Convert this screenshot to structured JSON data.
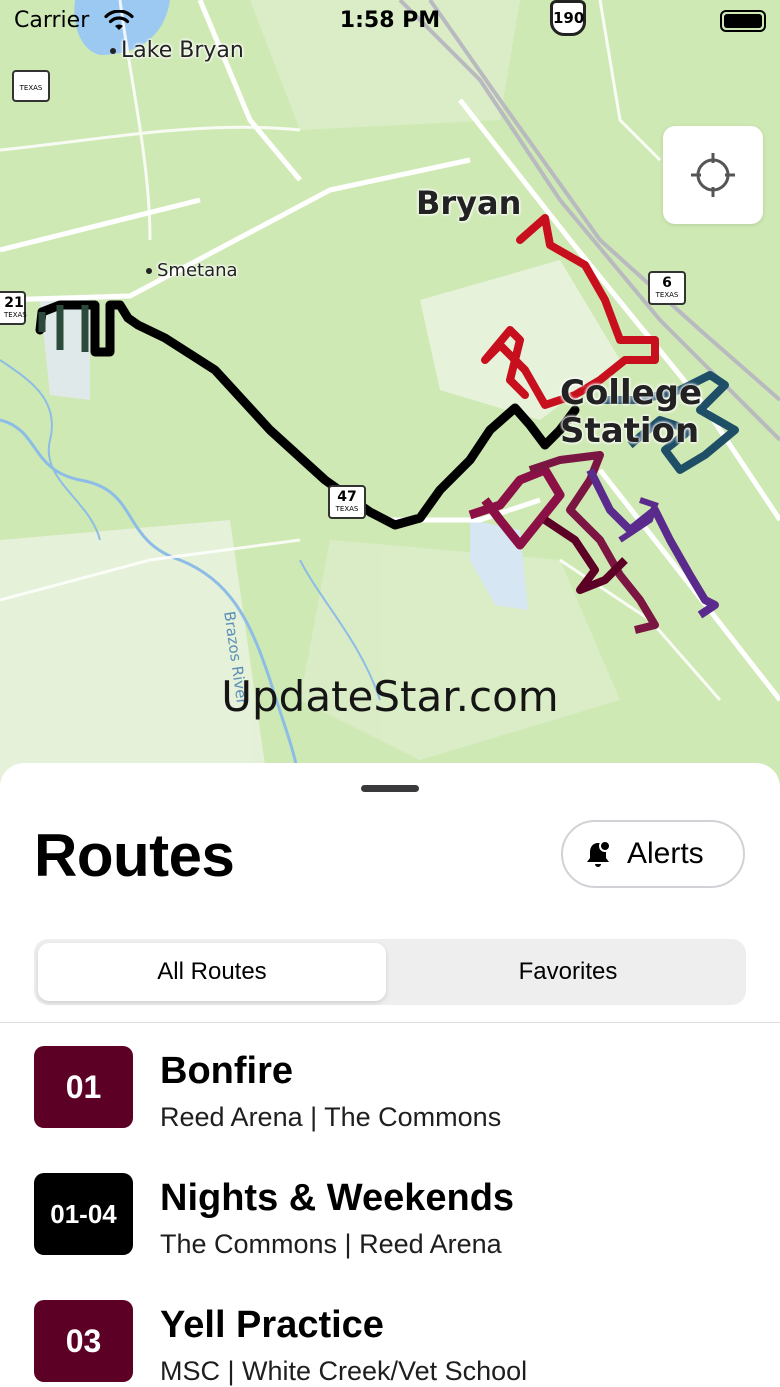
{
  "status_bar": {
    "carrier": "Carrier",
    "time": "1:58 PM"
  },
  "map": {
    "labels": {
      "lake_bryan": "Lake Bryan",
      "bryan": "Bryan",
      "smetana": "Smetana",
      "college_station_line1": "College",
      "college_station_line2": "Station",
      "river": "Brazos River"
    },
    "shields": {
      "texas_top_left": "TEXAS",
      "hwy_21": "21",
      "hwy_21_state": "TEXAS",
      "hwy_6": "6",
      "hwy_6_state": "TEXAS",
      "hwy_47": "47",
      "hwy_47_state": "TEXAS",
      "us_190": "190"
    },
    "watermark": "UpdateStar.com"
  },
  "sheet": {
    "title": "Routes",
    "alerts_label": "Alerts",
    "segments": {
      "all_routes": "All Routes",
      "favorites": "Favorites"
    },
    "routes": [
      {
        "number": "01",
        "name": "Bonfire",
        "stops": "Reed Arena | The Commons",
        "color": "#5c0025"
      },
      {
        "number": "01-04",
        "name": "Nights & Weekends",
        "stops": "The Commons | Reed Arena",
        "color": "#000000"
      },
      {
        "number": "03",
        "name": "Yell Practice",
        "stops": "MSC | White Creek/Vet School",
        "color": "#5c0025"
      }
    ]
  },
  "colors": {
    "map_green": "#cfe9b4",
    "maroon": "#5c0025",
    "route_red": "#c80f1e",
    "route_teal": "#1f4f67",
    "route_purple": "#5a2b8c"
  },
  "icons": {
    "wifi": "wifi-icon",
    "battery": "battery-icon",
    "locate": "location-crosshair-icon",
    "alerts": "bell-badge-icon"
  }
}
